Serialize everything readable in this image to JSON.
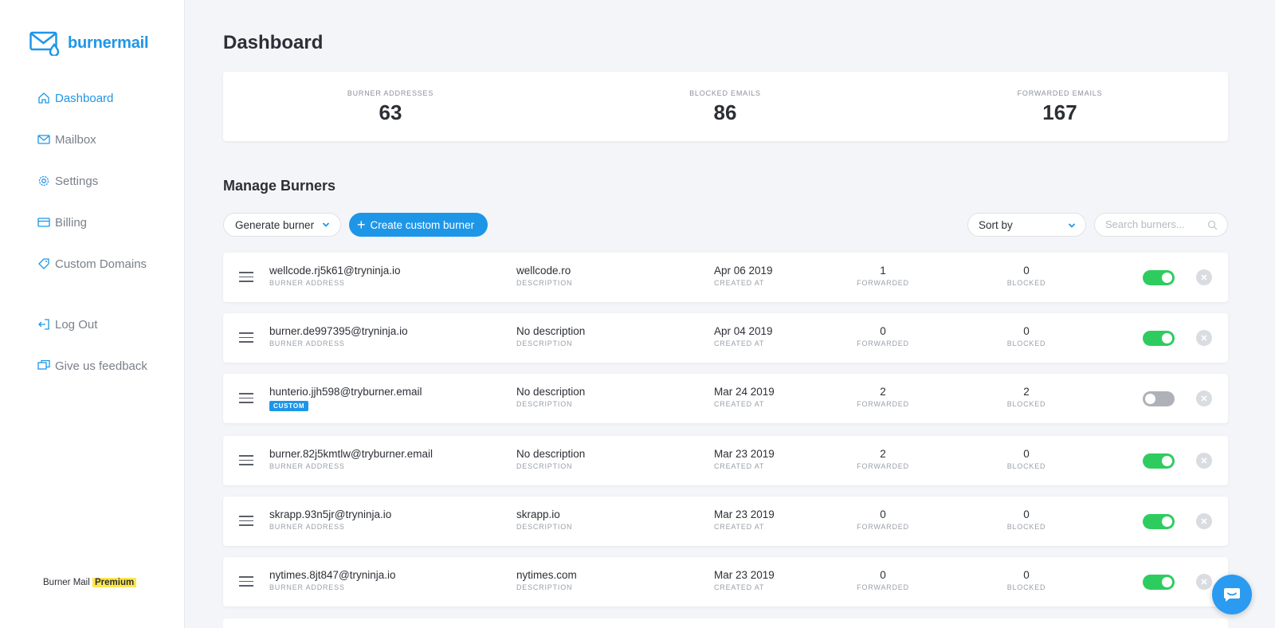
{
  "app": {
    "name": "burnermail"
  },
  "sidebar": {
    "items": [
      {
        "label": "Dashboard",
        "icon": "home-icon"
      },
      {
        "label": "Mailbox",
        "icon": "envelope-icon"
      },
      {
        "label": "Settings",
        "icon": "gear-icon"
      },
      {
        "label": "Billing",
        "icon": "credit-card-icon"
      },
      {
        "label": "Custom Domains",
        "icon": "tag-icon"
      }
    ],
    "secondary": [
      {
        "label": "Log Out",
        "icon": "logout-icon"
      },
      {
        "label": "Give us feedback",
        "icon": "feedback-icon"
      }
    ],
    "footer": {
      "text": "Burner Mail",
      "plan": "Premium"
    }
  },
  "page": {
    "title": "Dashboard"
  },
  "stats": [
    {
      "label": "BURNER ADDRESSES",
      "value": "63"
    },
    {
      "label": "BLOCKED EMAILS",
      "value": "86"
    },
    {
      "label": "FORWARDED EMAILS",
      "value": "167"
    }
  ],
  "manage": {
    "title": "Manage Burners",
    "generate_label": "Generate burner",
    "create_label": "Create custom burner",
    "sort_label": "Sort by",
    "search_placeholder": "Search burners..."
  },
  "labels": {
    "address": "BURNER ADDRESS",
    "description": "DESCRIPTION",
    "created": "CREATED AT",
    "forwarded": "FORWARDED",
    "blocked": "BLOCKED",
    "custom_badge": "CUSTOM"
  },
  "burners": [
    {
      "address": "wellcode.rj5k61@tryninja.io",
      "description": "wellcode.ro",
      "created": "Apr 06 2019",
      "forwarded": "1",
      "blocked": "0",
      "enabled": true,
      "custom": false
    },
    {
      "address": "burner.de997395@tryninja.io",
      "description": "No description",
      "created": "Apr 04 2019",
      "forwarded": "0",
      "blocked": "0",
      "enabled": true,
      "custom": false
    },
    {
      "address": "hunterio.jjh598@tryburner.email",
      "description": "No description",
      "created": "Mar 24 2019",
      "forwarded": "2",
      "blocked": "2",
      "enabled": false,
      "custom": true
    },
    {
      "address": "burner.82j5kmtlw@tryburner.email",
      "description": "No description",
      "created": "Mar 23 2019",
      "forwarded": "2",
      "blocked": "0",
      "enabled": true,
      "custom": false
    },
    {
      "address": "skrapp.93n5jr@tryninja.io",
      "description": "skrapp.io",
      "created": "Mar 23 2019",
      "forwarded": "0",
      "blocked": "0",
      "enabled": true,
      "custom": false
    },
    {
      "address": "nytimes.8jt847@tryninja.io",
      "description": "nytimes.com",
      "created": "Mar 23 2019",
      "forwarded": "0",
      "blocked": "0",
      "enabled": true,
      "custom": false
    }
  ],
  "colors": {
    "accent": "#1e96e8",
    "toggle_on": "#2ecc5f",
    "toggle_off": "#aeb2b8",
    "premium": "#fde74c"
  }
}
